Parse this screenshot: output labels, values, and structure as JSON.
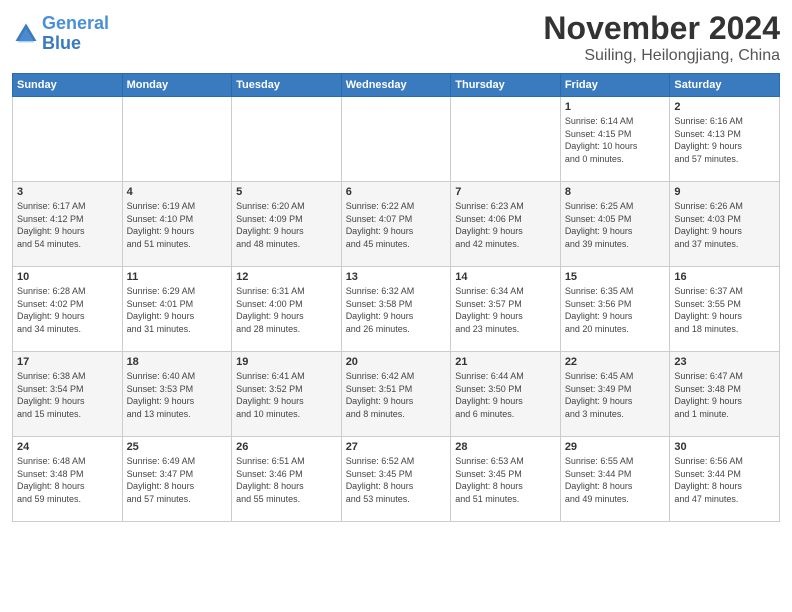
{
  "header": {
    "logo_line1": "General",
    "logo_line2": "Blue",
    "month": "November 2024",
    "location": "Suiling, Heilongjiang, China"
  },
  "days_of_week": [
    "Sunday",
    "Monday",
    "Tuesday",
    "Wednesday",
    "Thursday",
    "Friday",
    "Saturday"
  ],
  "weeks": [
    [
      {
        "day": "",
        "info": ""
      },
      {
        "day": "",
        "info": ""
      },
      {
        "day": "",
        "info": ""
      },
      {
        "day": "",
        "info": ""
      },
      {
        "day": "",
        "info": ""
      },
      {
        "day": "1",
        "info": "Sunrise: 6:14 AM\nSunset: 4:15 PM\nDaylight: 10 hours\nand 0 minutes."
      },
      {
        "day": "2",
        "info": "Sunrise: 6:16 AM\nSunset: 4:13 PM\nDaylight: 9 hours\nand 57 minutes."
      }
    ],
    [
      {
        "day": "3",
        "info": "Sunrise: 6:17 AM\nSunset: 4:12 PM\nDaylight: 9 hours\nand 54 minutes."
      },
      {
        "day": "4",
        "info": "Sunrise: 6:19 AM\nSunset: 4:10 PM\nDaylight: 9 hours\nand 51 minutes."
      },
      {
        "day": "5",
        "info": "Sunrise: 6:20 AM\nSunset: 4:09 PM\nDaylight: 9 hours\nand 48 minutes."
      },
      {
        "day": "6",
        "info": "Sunrise: 6:22 AM\nSunset: 4:07 PM\nDaylight: 9 hours\nand 45 minutes."
      },
      {
        "day": "7",
        "info": "Sunrise: 6:23 AM\nSunset: 4:06 PM\nDaylight: 9 hours\nand 42 minutes."
      },
      {
        "day": "8",
        "info": "Sunrise: 6:25 AM\nSunset: 4:05 PM\nDaylight: 9 hours\nand 39 minutes."
      },
      {
        "day": "9",
        "info": "Sunrise: 6:26 AM\nSunset: 4:03 PM\nDaylight: 9 hours\nand 37 minutes."
      }
    ],
    [
      {
        "day": "10",
        "info": "Sunrise: 6:28 AM\nSunset: 4:02 PM\nDaylight: 9 hours\nand 34 minutes."
      },
      {
        "day": "11",
        "info": "Sunrise: 6:29 AM\nSunset: 4:01 PM\nDaylight: 9 hours\nand 31 minutes."
      },
      {
        "day": "12",
        "info": "Sunrise: 6:31 AM\nSunset: 4:00 PM\nDaylight: 9 hours\nand 28 minutes."
      },
      {
        "day": "13",
        "info": "Sunrise: 6:32 AM\nSunset: 3:58 PM\nDaylight: 9 hours\nand 26 minutes."
      },
      {
        "day": "14",
        "info": "Sunrise: 6:34 AM\nSunset: 3:57 PM\nDaylight: 9 hours\nand 23 minutes."
      },
      {
        "day": "15",
        "info": "Sunrise: 6:35 AM\nSunset: 3:56 PM\nDaylight: 9 hours\nand 20 minutes."
      },
      {
        "day": "16",
        "info": "Sunrise: 6:37 AM\nSunset: 3:55 PM\nDaylight: 9 hours\nand 18 minutes."
      }
    ],
    [
      {
        "day": "17",
        "info": "Sunrise: 6:38 AM\nSunset: 3:54 PM\nDaylight: 9 hours\nand 15 minutes."
      },
      {
        "day": "18",
        "info": "Sunrise: 6:40 AM\nSunset: 3:53 PM\nDaylight: 9 hours\nand 13 minutes."
      },
      {
        "day": "19",
        "info": "Sunrise: 6:41 AM\nSunset: 3:52 PM\nDaylight: 9 hours\nand 10 minutes."
      },
      {
        "day": "20",
        "info": "Sunrise: 6:42 AM\nSunset: 3:51 PM\nDaylight: 9 hours\nand 8 minutes."
      },
      {
        "day": "21",
        "info": "Sunrise: 6:44 AM\nSunset: 3:50 PM\nDaylight: 9 hours\nand 6 minutes."
      },
      {
        "day": "22",
        "info": "Sunrise: 6:45 AM\nSunset: 3:49 PM\nDaylight: 9 hours\nand 3 minutes."
      },
      {
        "day": "23",
        "info": "Sunrise: 6:47 AM\nSunset: 3:48 PM\nDaylight: 9 hours\nand 1 minute."
      }
    ],
    [
      {
        "day": "24",
        "info": "Sunrise: 6:48 AM\nSunset: 3:48 PM\nDaylight: 8 hours\nand 59 minutes."
      },
      {
        "day": "25",
        "info": "Sunrise: 6:49 AM\nSunset: 3:47 PM\nDaylight: 8 hours\nand 57 minutes."
      },
      {
        "day": "26",
        "info": "Sunrise: 6:51 AM\nSunset: 3:46 PM\nDaylight: 8 hours\nand 55 minutes."
      },
      {
        "day": "27",
        "info": "Sunrise: 6:52 AM\nSunset: 3:45 PM\nDaylight: 8 hours\nand 53 minutes."
      },
      {
        "day": "28",
        "info": "Sunrise: 6:53 AM\nSunset: 3:45 PM\nDaylight: 8 hours\nand 51 minutes."
      },
      {
        "day": "29",
        "info": "Sunrise: 6:55 AM\nSunset: 3:44 PM\nDaylight: 8 hours\nand 49 minutes."
      },
      {
        "day": "30",
        "info": "Sunrise: 6:56 AM\nSunset: 3:44 PM\nDaylight: 8 hours\nand 47 minutes."
      }
    ]
  ]
}
